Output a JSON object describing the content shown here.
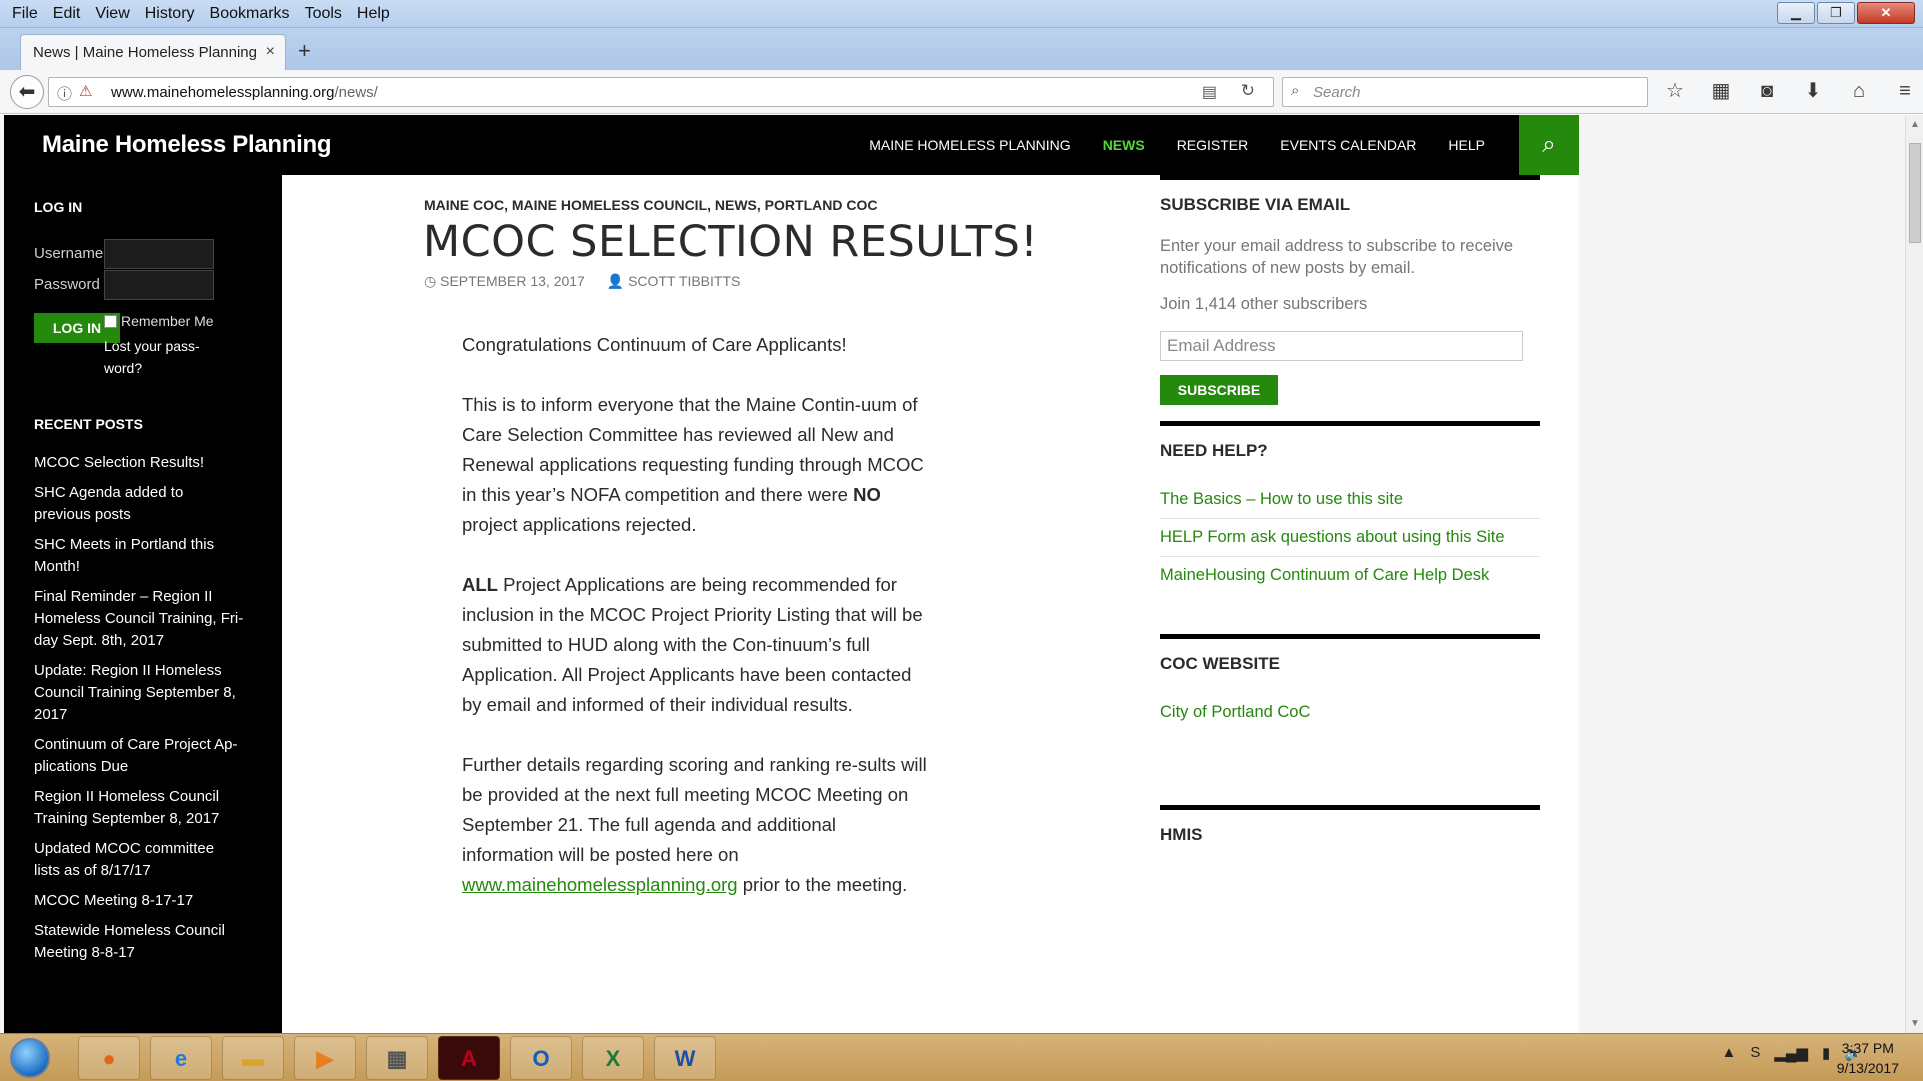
{
  "menubar": {
    "items": [
      "File",
      "Edit",
      "View",
      "History",
      "Bookmarks",
      "Tools",
      "Help"
    ]
  },
  "tabs": [
    {
      "title": "News | Maine Homeless Planning",
      "close": "×"
    }
  ],
  "new_tab": "+",
  "url": {
    "host": "www.mainehomelessplanning.org",
    "path": "/news/"
  },
  "search": {
    "placeholder": "Search"
  },
  "site": {
    "title": "Maine Homeless Planning",
    "nav": [
      "MAINE HOMELESS PLANNING",
      "NEWS",
      "REGISTER",
      "EVENTS CALENDAR",
      "HELP"
    ],
    "active_nav": "NEWS",
    "accent": "#24890d",
    "nav_active_color": "#55d737"
  },
  "login": {
    "title": "LOG IN",
    "username_label": "Username",
    "password_label": "Password",
    "button": "LOG IN",
    "remember": "Remember Me",
    "lost_password": "Lost your pass-word?"
  },
  "recent_posts": {
    "title": "RECENT POSTS",
    "items": [
      "MCOC Selection Results!",
      "SHC Agenda added to previous posts",
      "SHC Meets in Portland this Month!",
      "Final Reminder – Region II Homeless Council Training, Fri-day Sept. 8th, 2017",
      "Update: Region II Homeless Council Training September 8, 2017",
      "Continuum of Care Project Ap-plications Due",
      "Region II Homeless Council Training September 8, 2017",
      "Updated MCOC committee lists as of 8/17/17",
      "MCOC Meeting 8-17-17",
      "Statewide Homeless Council Meeting 8-8-17"
    ]
  },
  "post": {
    "categories": "MAINE COC, MAINE HOMELESS COUNCIL, NEWS, PORTLAND COC",
    "title": "MCOC SELECTION RESULTS!",
    "date": "SEPTEMBER 13, 2017",
    "author": "SCOTT TIBBITTS",
    "p1": "Congratulations Continuum of Care Applicants!",
    "p2_a": "This is to inform everyone that the Maine Contin-uum of Care Selection Committee has reviewed all New and Renewal applications requesting funding through MCOC in this year’s NOFA competition and there were ",
    "p2_bold": "NO",
    "p2_b": " project applications rejected.",
    "p3_bold": "ALL",
    "p3": " Project Applications are being recommended for inclusion in the MCOC Project Priority Listing that will be submitted to HUD along with the Con-tinuum’s full Application. All Project Applicants have been contacted by email and informed of their individual results.",
    "p4_a": "Further details regarding scoring and ranking re-sults will be provided at the next full meeting MCOC Meeting on September 21.   The full agenda and additional information will be posted here on ",
    "p4_link": "www.mainehomelessplanning.org",
    "p4_b": " prior to the meeting."
  },
  "subscribe": {
    "title": "SUBSCRIBE VIA EMAIL",
    "text": "Enter your email address to subscribe to receive notifications of new posts by email.",
    "subscribers": "Join 1,414 other subscribers",
    "placeholder": "Email Address",
    "button": "SUBSCRIBE"
  },
  "need_help": {
    "title": "NEED HELP?",
    "links": [
      "The Basics – How to use this site",
      "HELP Form ask questions about using this Site",
      "MaineHousing Continuum of Care Help Desk"
    ]
  },
  "coc_website": {
    "title": "COC WEBSITE",
    "link": "City of Portland CoC"
  },
  "hmis": {
    "title": "HMIS"
  },
  "taskbar": {
    "apps": [
      "Firefox",
      "Internet Explorer",
      "File Explorer",
      "Media Player",
      "Calculator",
      "Adobe Acrobat",
      "Outlook",
      "Excel",
      "Word"
    ],
    "time": "3:37 PM",
    "date": "9/13/2017"
  }
}
